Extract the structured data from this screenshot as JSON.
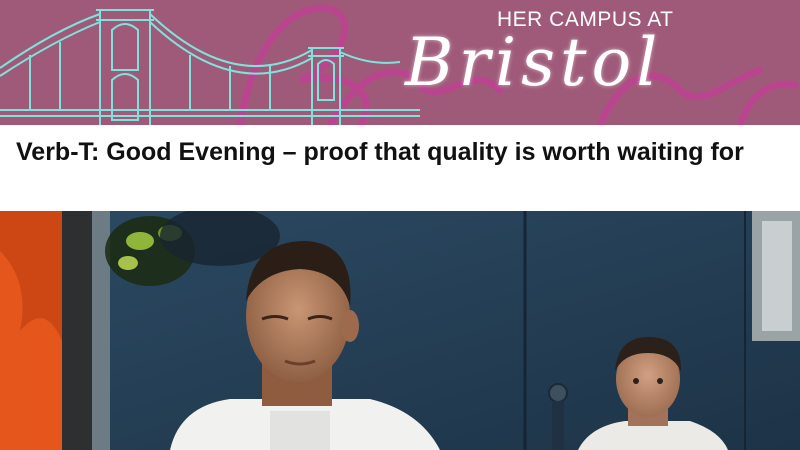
{
  "banner": {
    "kicker": "HER CAMPUS AT",
    "city": "Bristol",
    "background_color": "#a05a79",
    "bridge_line_color": "#7fe3dc",
    "watermark_color": "#c23f96"
  },
  "article": {
    "title": "Verb-T: Good Evening – proof that quality is worth waiting for"
  },
  "hero": {
    "description_icon": "photo-two-men-in-white-t-shirts"
  }
}
